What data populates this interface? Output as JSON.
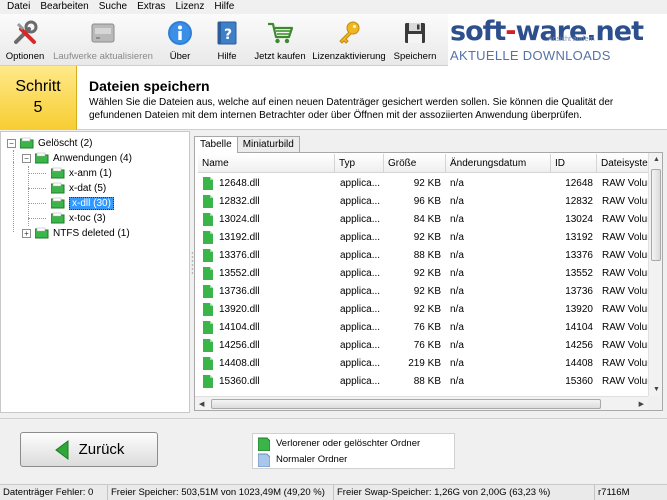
{
  "menu": [
    "Datei",
    "Bearbeiten",
    "Suche",
    "Extras",
    "Lizenz",
    "Hilfe"
  ],
  "toolbar": {
    "optionen": "Optionen",
    "laufwerke": "Laufwerke aktualisieren",
    "ueber": "Über",
    "hilfe": "Hilfe",
    "kaufen": "Jetzt kaufen",
    "lizenz": "Lizenzaktivierung",
    "speichern": "Speichern"
  },
  "logo": {
    "part1": "soft",
    "dash": "-",
    "part2": "ware.net",
    "tagline": "AKTUELLE DOWNLOADS",
    "ghost": "Ansicht ändern"
  },
  "step": {
    "label": "Schritt",
    "number": "5",
    "title": "Dateien speichern",
    "description": "Wählen Sie die Dateien aus, welche auf einen neuen Datenträger gesichert werden sollen. Sie können die Qualität der gefundenen Dateien mit dem internen Betrachter oder über Öffnen mit der assoziierten Anwendung überprüfen."
  },
  "tree": {
    "root": "Gelöscht (2)",
    "apps": "Anwendungen (4)",
    "x_anm": "x-anm (1)",
    "x_dat": "x-dat (5)",
    "x_dll": "x-dll (30)",
    "x_toc": "x-toc (3)",
    "ntfs": "NTFS deleted (1)"
  },
  "tabs": {
    "table": "Tabelle",
    "thumbs": "Miniaturbild"
  },
  "columns": {
    "name": "Name",
    "typ": "Typ",
    "groesse": "Größe",
    "datum": "Änderungsdatum",
    "id": "ID",
    "system": "Dateisystem"
  },
  "rows": [
    {
      "name": "12648.dll",
      "typ": "applica...",
      "groesse": "92 KB",
      "datum": "n/a",
      "id": "12648",
      "system": "RAW Volume"
    },
    {
      "name": "12832.dll",
      "typ": "applica...",
      "groesse": "96 KB",
      "datum": "n/a",
      "id": "12832",
      "system": "RAW Volume"
    },
    {
      "name": "13024.dll",
      "typ": "applica...",
      "groesse": "84 KB",
      "datum": "n/a",
      "id": "13024",
      "system": "RAW Volume"
    },
    {
      "name": "13192.dll",
      "typ": "applica...",
      "groesse": "92 KB",
      "datum": "n/a",
      "id": "13192",
      "system": "RAW Volume"
    },
    {
      "name": "13376.dll",
      "typ": "applica...",
      "groesse": "88 KB",
      "datum": "n/a",
      "id": "13376",
      "system": "RAW Volume"
    },
    {
      "name": "13552.dll",
      "typ": "applica...",
      "groesse": "92 KB",
      "datum": "n/a",
      "id": "13552",
      "system": "RAW Volume"
    },
    {
      "name": "13736.dll",
      "typ": "applica...",
      "groesse": "92 KB",
      "datum": "n/a",
      "id": "13736",
      "system": "RAW Volume"
    },
    {
      "name": "13920.dll",
      "typ": "applica...",
      "groesse": "92 KB",
      "datum": "n/a",
      "id": "13920",
      "system": "RAW Volume"
    },
    {
      "name": "14104.dll",
      "typ": "applica...",
      "groesse": "76 KB",
      "datum": "n/a",
      "id": "14104",
      "system": "RAW Volume"
    },
    {
      "name": "14256.dll",
      "typ": "applica...",
      "groesse": "76 KB",
      "datum": "n/a",
      "id": "14256",
      "system": "RAW Volume"
    },
    {
      "name": "14408.dll",
      "typ": "applica...",
      "groesse": "219 KB",
      "datum": "n/a",
      "id": "14408",
      "system": "RAW Volume"
    },
    {
      "name": "15360.dll",
      "typ": "applica...",
      "groesse": "88 KB",
      "datum": "n/a",
      "id": "15360",
      "system": "RAW Volume"
    }
  ],
  "buttons": {
    "back": "Zurück"
  },
  "legend": {
    "lost": "Verlorener oder gelöschter Ordner",
    "normal": "Normaler Ordner"
  },
  "status": {
    "errors": "Datenträger Fehler: 0",
    "ram": "Freier Speicher: 503,51M von 1023,49M (49,20 %)",
    "swap": "Freier Swap-Speicher: 1,26G von 2,00G (63,23 %)",
    "build": "r7116M"
  },
  "colors": {
    "accent": "#f7cd31",
    "folder_green": "#3bb54a",
    "logo_blue": "#2d4f8e",
    "logo_red": "#d31f26",
    "selection": "#3399ff"
  }
}
